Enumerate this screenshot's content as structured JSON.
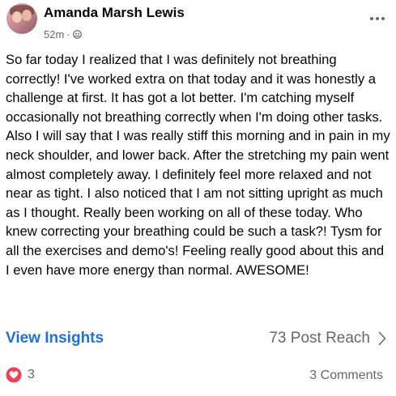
{
  "post": {
    "author": "Amanda Marsh Lewis",
    "timestamp": "52m",
    "separator": "·",
    "privacy_icon": "friends-icon",
    "body": "So far today I realized that I was definitely not breathing correctly! I've worked extra on that today and it was honestly a challenge at first. It has got a lot better. I'm catching myself occasionally not breathing correctly when I'm doing other tasks. Also I will say that I was really stiff this morning and in pain in my neck shoulder, and lower back. After the stretching my pain went almost completely away. I definitely feel more relaxed and not near as tight. I also noticed that I am not sitting upright as much as I thought. Really been working on all of these today. Who knew correcting your breathing could be such a task?! Tysm for all the exercises and demo's! Feeling really good about this and I even have more energy than normal. AWESOME!"
  },
  "insights": {
    "view_label": "View Insights",
    "reach_label": "73 Post Reach"
  },
  "footer": {
    "reaction_count": "3",
    "reaction_icon": "love-icon",
    "comments_label": "3 Comments"
  },
  "colors": {
    "link_blue": "#216fdb",
    "secondary_text": "#65676b",
    "love_red": "#f33e58"
  }
}
